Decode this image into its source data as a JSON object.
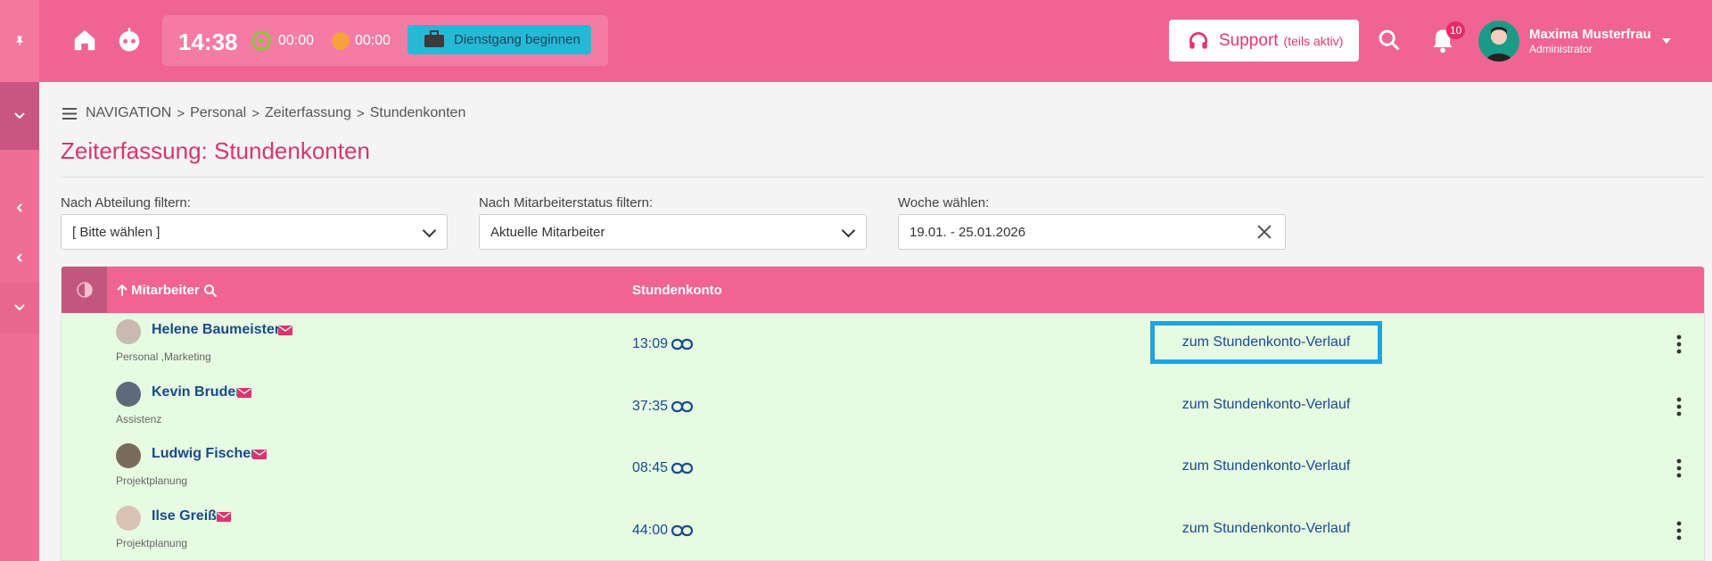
{
  "rail": {
    "pin_icon": "pin-icon",
    "toggle_icon": "chevron-down-icon",
    "items": [
      "chevron-left-icon",
      "chevron-left-icon",
      "chevron-down-icon"
    ]
  },
  "topbar": {
    "clock": "14:38",
    "timer_work": "00:00",
    "timer_pause": "00:00",
    "dienstgang_label": "Dienstgang beginnen",
    "support_label": "Support",
    "support_sub": "(teils aktiv)",
    "notifications_count": "10",
    "user_name": "Maxima Musterfrau",
    "user_role": "Administrator"
  },
  "breadcrumb": {
    "items": [
      "NAVIGATION",
      "Personal",
      "Zeiterfassung",
      "Stundenkonten"
    ]
  },
  "page_title": "Zeiterfassung: Stundenkonten",
  "filters": {
    "department": {
      "label": "Nach Abteilung filtern:",
      "value": "[ Bitte wählen ]"
    },
    "status": {
      "label": "Nach Mitarbeiterstatus filtern:",
      "value": "Aktuelle Mitarbeiter"
    },
    "week": {
      "label": "Woche wählen:",
      "value": "19.01. - 25.01.2026"
    }
  },
  "table": {
    "col_employee": "Mitarbeiter",
    "col_account": "Stundenkonto",
    "rows": [
      {
        "name": "Helene Baumeister",
        "dept": "Personal ,Marketing",
        "time": "13:09",
        "link": "zum Stundenkonto-Verlauf",
        "avatar_color": "#c9b9b0"
      },
      {
        "name": "Kevin Bruder",
        "dept": "Assistenz",
        "time": "37:35",
        "link": "zum Stundenkonto-Verlauf",
        "avatar_color": "#5e6a7a"
      },
      {
        "name": "Ludwig Fischer",
        "dept": "Projektplanung",
        "time": "08:45",
        "link": "zum Stundenkonto-Verlauf",
        "avatar_color": "#7a6a5a"
      },
      {
        "name": "Ilse Greiß",
        "dept": "Projektplanung",
        "time": "44:00",
        "link": "zum Stundenkonto-Verlauf",
        "avatar_color": "#d9c2b5"
      }
    ]
  },
  "colors": {
    "brand_pink": "#f06493",
    "title_pink": "#d8366f",
    "row_green": "#e6fbe2",
    "link_blue": "#1a4a8a",
    "focus_blue": "#1fa4de"
  }
}
